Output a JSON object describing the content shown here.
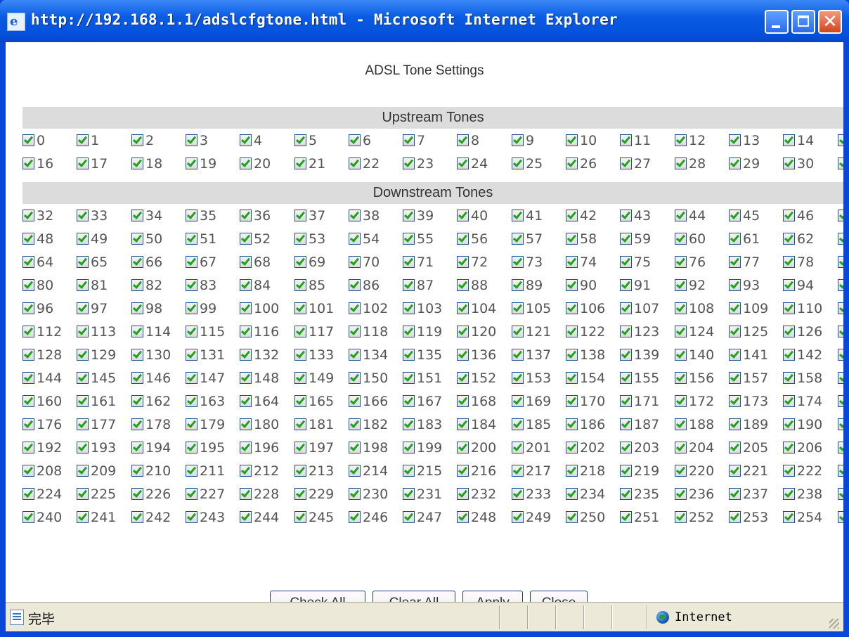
{
  "window": {
    "title": "http://192.168.1.1/adslcfgtone.html - Microsoft Internet Explorer",
    "controls": [
      "minimize",
      "maximize",
      "close"
    ]
  },
  "page": {
    "title": "ADSL Tone Settings",
    "upstream_header": "Upstream Tones",
    "downstream_header": "Downstream Tones"
  },
  "tones": {
    "checked": true,
    "upstream_rows": [
      [
        "0",
        "1",
        "2",
        "3",
        "4",
        "5",
        "6",
        "7",
        "8",
        "9",
        "10",
        "11",
        "12",
        "13",
        "14"
      ],
      [
        "16",
        "17",
        "18",
        "19",
        "20",
        "21",
        "22",
        "23",
        "24",
        "25",
        "26",
        "27",
        "28",
        "29",
        "30"
      ]
    ],
    "downstream_rows": [
      [
        "32",
        "33",
        "34",
        "35",
        "36",
        "37",
        "38",
        "39",
        "40",
        "41",
        "42",
        "43",
        "44",
        "45",
        "46"
      ],
      [
        "48",
        "49",
        "50",
        "51",
        "52",
        "53",
        "54",
        "55",
        "56",
        "57",
        "58",
        "59",
        "60",
        "61",
        "62"
      ],
      [
        "64",
        "65",
        "66",
        "67",
        "68",
        "69",
        "70",
        "71",
        "72",
        "73",
        "74",
        "75",
        "76",
        "77",
        "78"
      ],
      [
        "80",
        "81",
        "82",
        "83",
        "84",
        "85",
        "86",
        "87",
        "88",
        "89",
        "90",
        "91",
        "92",
        "93",
        "94"
      ],
      [
        "96",
        "97",
        "98",
        "99",
        "100",
        "101",
        "102",
        "103",
        "104",
        "105",
        "106",
        "107",
        "108",
        "109",
        "110"
      ],
      [
        "112",
        "113",
        "114",
        "115",
        "116",
        "117",
        "118",
        "119",
        "120",
        "121",
        "122",
        "123",
        "124",
        "125",
        "126"
      ],
      [
        "128",
        "129",
        "130",
        "131",
        "132",
        "133",
        "134",
        "135",
        "136",
        "137",
        "138",
        "139",
        "140",
        "141",
        "142"
      ],
      [
        "144",
        "145",
        "146",
        "147",
        "148",
        "149",
        "150",
        "151",
        "152",
        "153",
        "154",
        "155",
        "156",
        "157",
        "158"
      ],
      [
        "160",
        "161",
        "162",
        "163",
        "164",
        "165",
        "166",
        "167",
        "168",
        "169",
        "170",
        "171",
        "172",
        "173",
        "174"
      ],
      [
        "176",
        "177",
        "178",
        "179",
        "180",
        "181",
        "182",
        "183",
        "184",
        "185",
        "186",
        "187",
        "188",
        "189",
        "190"
      ],
      [
        "192",
        "193",
        "194",
        "195",
        "196",
        "197",
        "198",
        "199",
        "200",
        "201",
        "202",
        "203",
        "204",
        "205",
        "206"
      ],
      [
        "208",
        "209",
        "210",
        "211",
        "212",
        "213",
        "214",
        "215",
        "216",
        "217",
        "218",
        "219",
        "220",
        "221",
        "222"
      ],
      [
        "224",
        "225",
        "226",
        "227",
        "228",
        "229",
        "230",
        "231",
        "232",
        "233",
        "234",
        "235",
        "236",
        "237",
        "238"
      ],
      [
        "240",
        "241",
        "242",
        "243",
        "244",
        "245",
        "246",
        "247",
        "248",
        "249",
        "250",
        "251",
        "252",
        "253",
        "254"
      ]
    ]
  },
  "buttons": {
    "check_all": "Check All",
    "clear_all": "Clear All",
    "apply": "Apply",
    "close": "Close"
  },
  "statusbar": {
    "status_text": "完毕",
    "zone": "Internet"
  }
}
